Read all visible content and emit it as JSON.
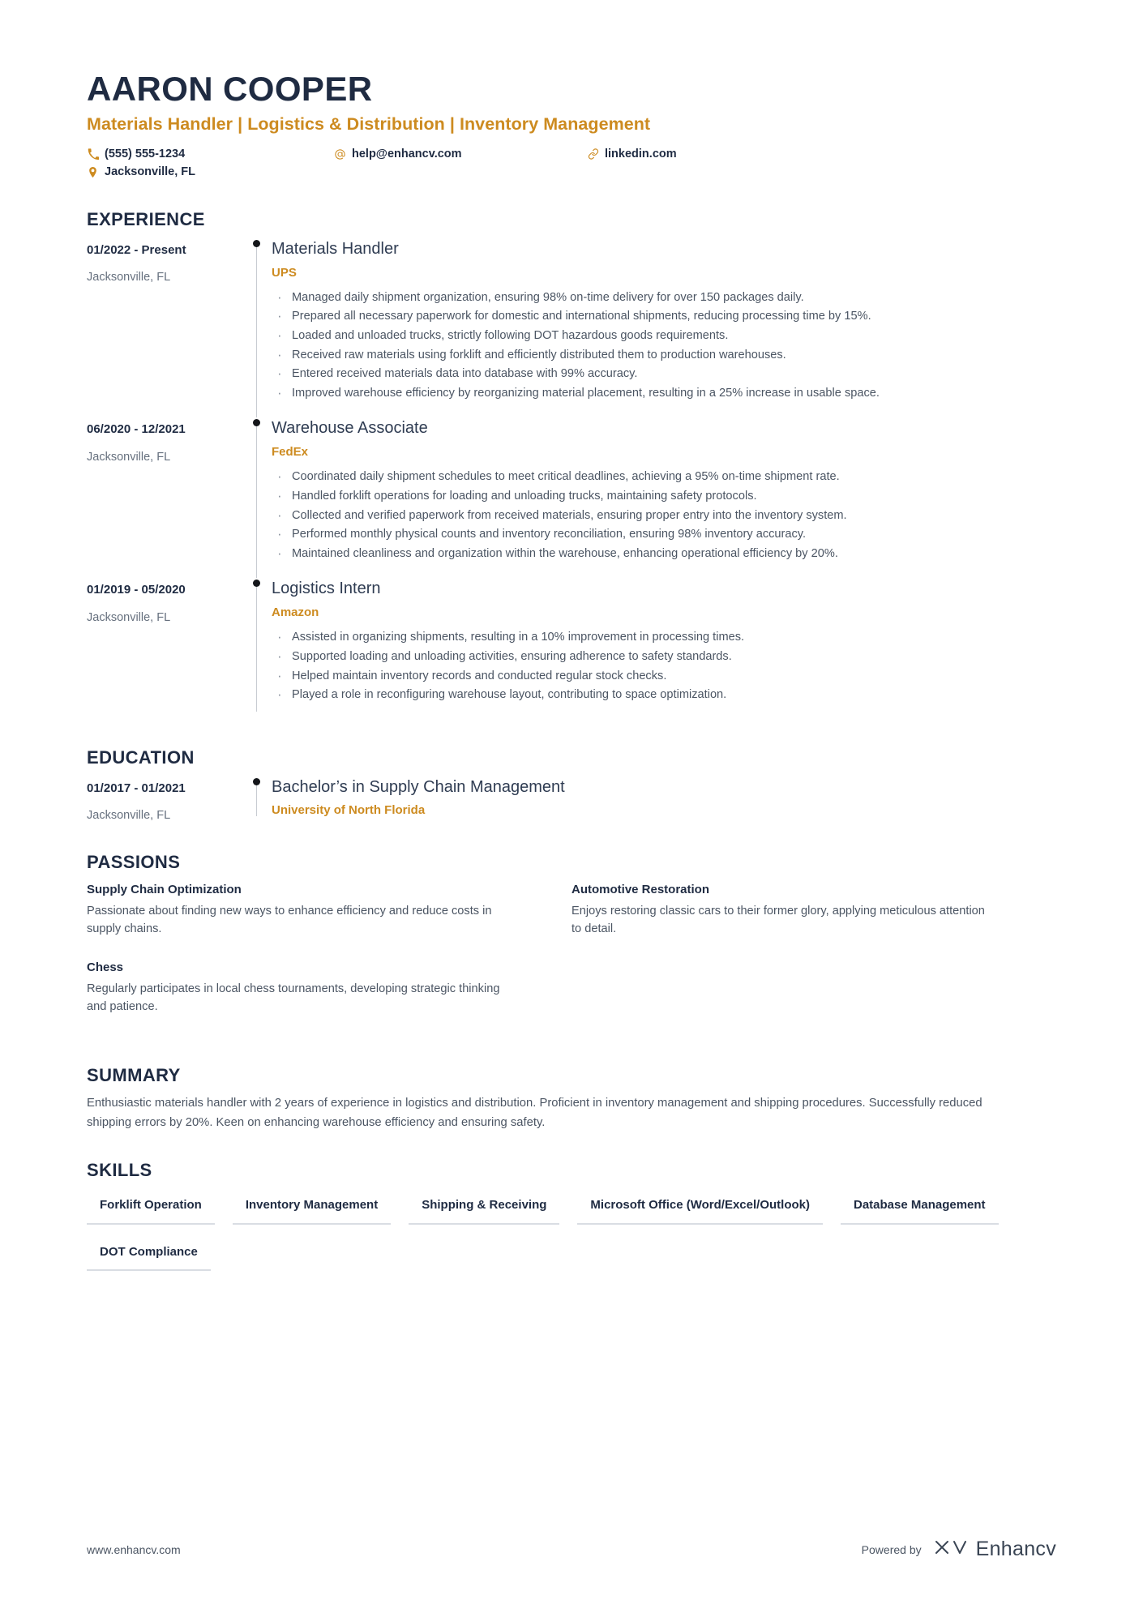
{
  "header": {
    "name": "AARON COOPER",
    "headline": "Materials Handler | Logistics & Distribution | Inventory Management",
    "contacts": {
      "phone": "(555) 555-1234",
      "email": "help@enhancv.com",
      "linkedin": "linkedin.com",
      "location": "Jacksonville, FL"
    },
    "icons": {
      "phone": "phone-icon",
      "email": "at-sign-icon",
      "linkedin": "link-icon",
      "location": "map-pin-icon"
    }
  },
  "sections": {
    "experience_title": "EXPERIENCE",
    "education_title": "EDUCATION",
    "passions_title": "PASSIONS",
    "summary_title": "SUMMARY",
    "skills_title": "SKILLS"
  },
  "experience": [
    {
      "date": "01/2022 - Present",
      "location": "Jacksonville, FL",
      "title": "Materials Handler",
      "company": "UPS",
      "bullets": [
        "Managed daily shipment organization, ensuring 98% on-time delivery for over 150 packages daily.",
        "Prepared all necessary paperwork for domestic and international shipments, reducing processing time by 15%.",
        "Loaded and unloaded trucks, strictly following DOT hazardous goods requirements.",
        "Received raw materials using forklift and efficiently distributed them to production warehouses.",
        "Entered received materials data into database with 99% accuracy.",
        "Improved warehouse efficiency by reorganizing material placement, resulting in a 25% increase in usable space."
      ]
    },
    {
      "date": "06/2020 - 12/2021",
      "location": "Jacksonville, FL",
      "title": "Warehouse Associate",
      "company": "FedEx",
      "bullets": [
        "Coordinated daily shipment schedules to meet critical deadlines, achieving a 95% on-time shipment rate.",
        "Handled forklift operations for loading and unloading trucks, maintaining safety protocols.",
        "Collected and verified paperwork from received materials, ensuring proper entry into the inventory system.",
        "Performed monthly physical counts and inventory reconciliation, ensuring 98% inventory accuracy.",
        "Maintained cleanliness and organization within the warehouse, enhancing operational efficiency by 20%."
      ]
    },
    {
      "date": "01/2019 - 05/2020",
      "location": "Jacksonville, FL",
      "title": "Logistics Intern",
      "company": "Amazon",
      "bullets": [
        "Assisted in organizing shipments, resulting in a 10% improvement in processing times.",
        "Supported loading and unloading activities, ensuring adherence to safety standards.",
        "Helped maintain inventory records and conducted regular stock checks.",
        "Played a role in reconfiguring warehouse layout, contributing to space optimization."
      ]
    }
  ],
  "education": [
    {
      "date": "01/2017 - 01/2021",
      "location": "Jacksonville, FL",
      "degree": "Bachelor’s in Supply Chain Management",
      "school": "University of North Florida"
    }
  ],
  "passions": [
    {
      "title": "Supply Chain Optimization",
      "desc": "Passionate about finding new ways to enhance efficiency and reduce costs in supply chains."
    },
    {
      "title": "Automotive Restoration",
      "desc": "Enjoys restoring classic cars to their former glory, applying meticulous attention to detail."
    },
    {
      "title": "Chess",
      "desc": "Regularly participates in local chess tournaments, developing strategic thinking and patience."
    }
  ],
  "summary": {
    "text": "Enthusiastic materials handler with 2 years of experience in logistics and distribution. Proficient in inventory management and shipping procedures. Successfully reduced shipping errors by 20%. Keen on enhancing warehouse efficiency and ensuring safety."
  },
  "skills": [
    "Forklift Operation",
    "Inventory Management",
    "Shipping & Receiving",
    "Microsoft Office (Word/Excel/Outlook)",
    "Database Management",
    "DOT Compliance"
  ],
  "footer": {
    "url": "www.enhancv.com",
    "powered_by": "Powered by",
    "brand": "Enhancv",
    "brand_icon": "enhancv-logo-icon"
  },
  "colors": {
    "accent": "#cd8b20",
    "heading": "#1f2b42",
    "body": "#4b5563",
    "muted": "#66707e",
    "rule": "#d9dde3"
  }
}
